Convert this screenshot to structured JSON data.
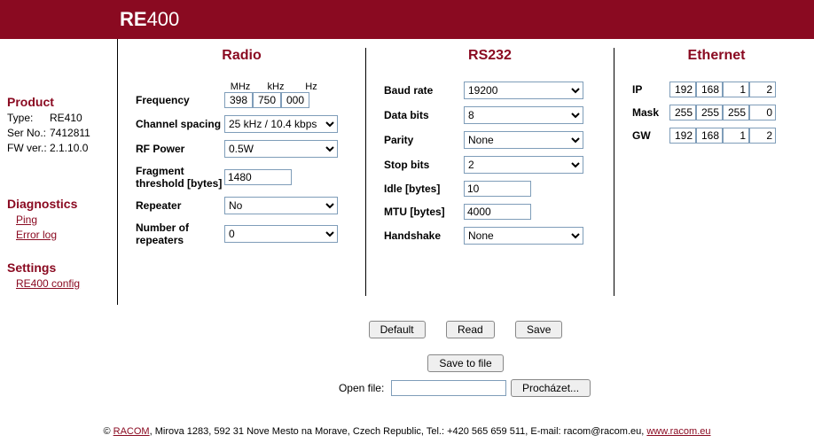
{
  "header": {
    "prefix": "RE",
    "suffix": "400"
  },
  "product": {
    "head": "Product",
    "type_label": "Type:",
    "type_value": "RE410",
    "ser_label": "Ser No.:",
    "ser_value": "7412811",
    "fw_label": "FW ver.:",
    "fw_value": "2.1.10.0"
  },
  "diagnostics": {
    "head": "Diagnostics",
    "ping": "Ping",
    "errorlog": "Error log"
  },
  "settings": {
    "head": "Settings",
    "config": "RE400 config"
  },
  "radio": {
    "title": "Radio",
    "freq_label": "Frequency",
    "freq_units": {
      "mhz": "MHz",
      "khz": "kHz",
      "hz": "Hz"
    },
    "freq_mhz": "398",
    "freq_khz": "750",
    "freq_hz": "000",
    "chspacing_label": "Channel spacing",
    "chspacing": "25 kHz / 10.4 kbps",
    "rfpower_label": "RF Power",
    "rfpower": "0.5W",
    "frag_label": "Fragment threshold [bytes]",
    "frag": "1480",
    "repeater_label": "Repeater",
    "repeater": "No",
    "numrep_label": "Number of repeaters",
    "numrep": "0"
  },
  "rs232": {
    "title": "RS232",
    "baud_label": "Baud rate",
    "baud": "19200",
    "databits_label": "Data bits",
    "databits": "8",
    "parity_label": "Parity",
    "parity": "None",
    "stopbits_label": "Stop bits",
    "stopbits": "2",
    "idle_label": "Idle [bytes]",
    "idle": "10",
    "mtu_label": "MTU [bytes]",
    "mtu": "4000",
    "handshake_label": "Handshake",
    "handshake": "None"
  },
  "ethernet": {
    "title": "Ethernet",
    "ip_label": "IP",
    "ip": [
      "192",
      "168",
      "1",
      "2"
    ],
    "mask_label": "Mask",
    "mask": [
      "255",
      "255",
      "255",
      "0"
    ],
    "gw_label": "GW",
    "gw": [
      "192",
      "168",
      "1",
      "2"
    ]
  },
  "buttons": {
    "default": "Default",
    "read": "Read",
    "save": "Save",
    "savefile": "Save to file",
    "openfile_label": "Open file:",
    "browse": "Procházet..."
  },
  "footer": {
    "copy": "© ",
    "company": "RACOM",
    "rest": ", Mirova 1283, 592 31 Nove Mesto na Morave, Czech Republic, Tel.: +420 565 659 511, E-mail: racom@racom.eu, ",
    "site": "www.racom.eu"
  }
}
